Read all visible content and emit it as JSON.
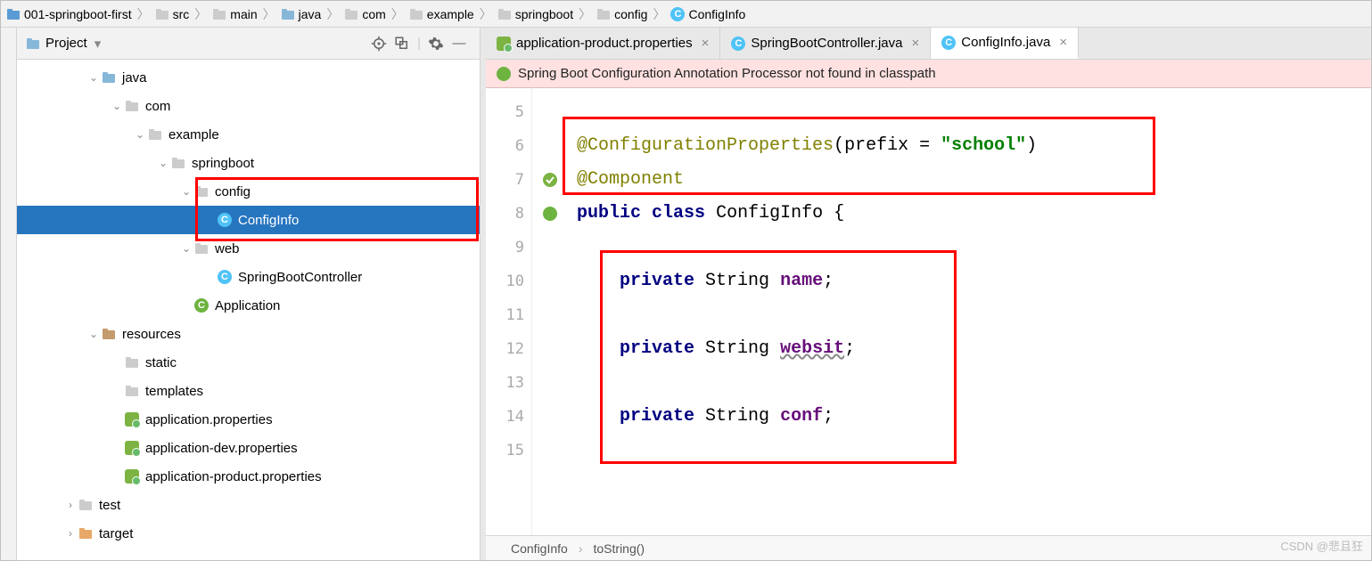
{
  "breadcrumb": [
    "001-springboot-first",
    "src",
    "main",
    "java",
    "com",
    "example",
    "springboot",
    "config",
    "ConfigInfo"
  ],
  "breadcrumb_types": [
    "module",
    "folder",
    "folder",
    "folder-src",
    "pkg",
    "pkg",
    "pkg",
    "pkg",
    "class"
  ],
  "project_panel": {
    "title": "Project"
  },
  "tree": [
    {
      "depth": 3,
      "tw": "v",
      "icon": "folder-src",
      "label": "java"
    },
    {
      "depth": 4,
      "tw": "v",
      "icon": "pkg",
      "label": "com"
    },
    {
      "depth": 5,
      "tw": "v",
      "icon": "pkg",
      "label": "example"
    },
    {
      "depth": 6,
      "tw": "v",
      "icon": "pkg",
      "label": "springboot"
    },
    {
      "depth": 7,
      "tw": "v",
      "icon": "pkg",
      "label": "config"
    },
    {
      "depth": 8,
      "tw": "",
      "icon": "class",
      "label": "ConfigInfo",
      "selected": true
    },
    {
      "depth": 7,
      "tw": "v",
      "icon": "pkg",
      "label": "web"
    },
    {
      "depth": 8,
      "tw": "",
      "icon": "class",
      "label": "SpringBootController"
    },
    {
      "depth": 7,
      "tw": "",
      "icon": "spring-class",
      "label": "Application"
    },
    {
      "depth": 3,
      "tw": "v",
      "icon": "folder-res",
      "label": "resources"
    },
    {
      "depth": 4,
      "tw": "",
      "icon": "folder",
      "label": "static"
    },
    {
      "depth": 4,
      "tw": "",
      "icon": "folder",
      "label": "templates"
    },
    {
      "depth": 4,
      "tw": "",
      "icon": "prop",
      "label": "application.properties"
    },
    {
      "depth": 4,
      "tw": "",
      "icon": "prop",
      "label": "application-dev.properties"
    },
    {
      "depth": 4,
      "tw": "",
      "icon": "prop",
      "label": "application-product.properties"
    },
    {
      "depth": 2,
      "tw": ">",
      "icon": "folder",
      "label": "test"
    },
    {
      "depth": 2,
      "tw": ">",
      "icon": "folder-target",
      "label": "target"
    }
  ],
  "tabs": [
    {
      "icon": "prop",
      "label": "application-product.properties",
      "active": false
    },
    {
      "icon": "class",
      "label": "SpringBootController.java",
      "active": false
    },
    {
      "icon": "class",
      "label": "ConfigInfo.java",
      "active": true
    }
  ],
  "banner": "Spring Boot Configuration Annotation Processor not found in classpath",
  "gutter_start": 5,
  "gutter_end": 15,
  "code": {
    "ann1a": "@ConfigurationProperties",
    "paren_open": "(",
    "prefix_kw": "prefix = ",
    "str_q": "\"",
    "str_v": "school",
    "paren_close": ")",
    "ann2": "@Component",
    "l8_kw1": "public",
    "l8_kw2": "class",
    "l8_cls": "ConfigInfo",
    "l8_br": "{",
    "priv": "private",
    "type": "String",
    "f1": "name",
    "f2": "websit",
    "f3": "conf",
    "semi": ";"
  },
  "status": {
    "a": "ConfigInfo",
    "b": "toString()"
  },
  "watermark": "CSDN @悲且狂"
}
